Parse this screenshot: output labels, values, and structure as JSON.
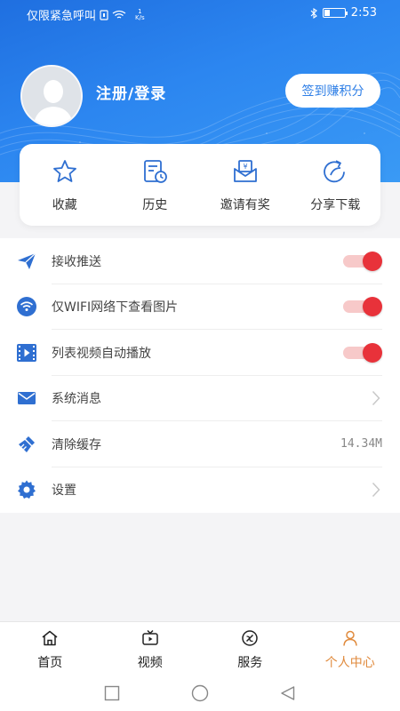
{
  "status_bar": {
    "carrier": "仅限紧急呼叫",
    "speed_value": "1",
    "speed_unit": "K/s",
    "battery_text": "10",
    "time": "2:53"
  },
  "profile": {
    "login_label": "注册/登录",
    "signin_button": "签到赚积分"
  },
  "quick_actions": [
    {
      "label": "收藏",
      "icon": "star-icon"
    },
    {
      "label": "历史",
      "icon": "history-icon"
    },
    {
      "label": "邀请有奖",
      "icon": "invite-reward-icon"
    },
    {
      "label": "分享下载",
      "icon": "share-icon"
    }
  ],
  "settings": [
    {
      "label": "接收推送",
      "icon": "send-icon",
      "control": "toggle",
      "on": true
    },
    {
      "label": "仅WIFI网络下查看图片",
      "icon": "wifi-icon",
      "control": "toggle",
      "on": true
    },
    {
      "label": "列表视频自动播放",
      "icon": "video-icon",
      "control": "toggle",
      "on": true
    },
    {
      "label": "系统消息",
      "icon": "mail-icon",
      "control": "chevron"
    },
    {
      "label": "清除缓存",
      "icon": "broom-icon",
      "control": "value",
      "value": "14.34M"
    },
    {
      "label": "设置",
      "icon": "gear-icon",
      "control": "chevron"
    }
  ],
  "tabs": [
    {
      "label": "首页",
      "icon": "home-icon",
      "active": false
    },
    {
      "label": "视频",
      "icon": "tv-icon",
      "active": false
    },
    {
      "label": "服务",
      "icon": "service-icon",
      "active": false
    },
    {
      "label": "个人中心",
      "icon": "person-icon",
      "active": true
    }
  ],
  "colors": {
    "header_blue": "#2c86f0",
    "toggle_on": "#e8323a",
    "icon_blue": "#2f6fd1",
    "tab_active": "#e08a3c"
  }
}
